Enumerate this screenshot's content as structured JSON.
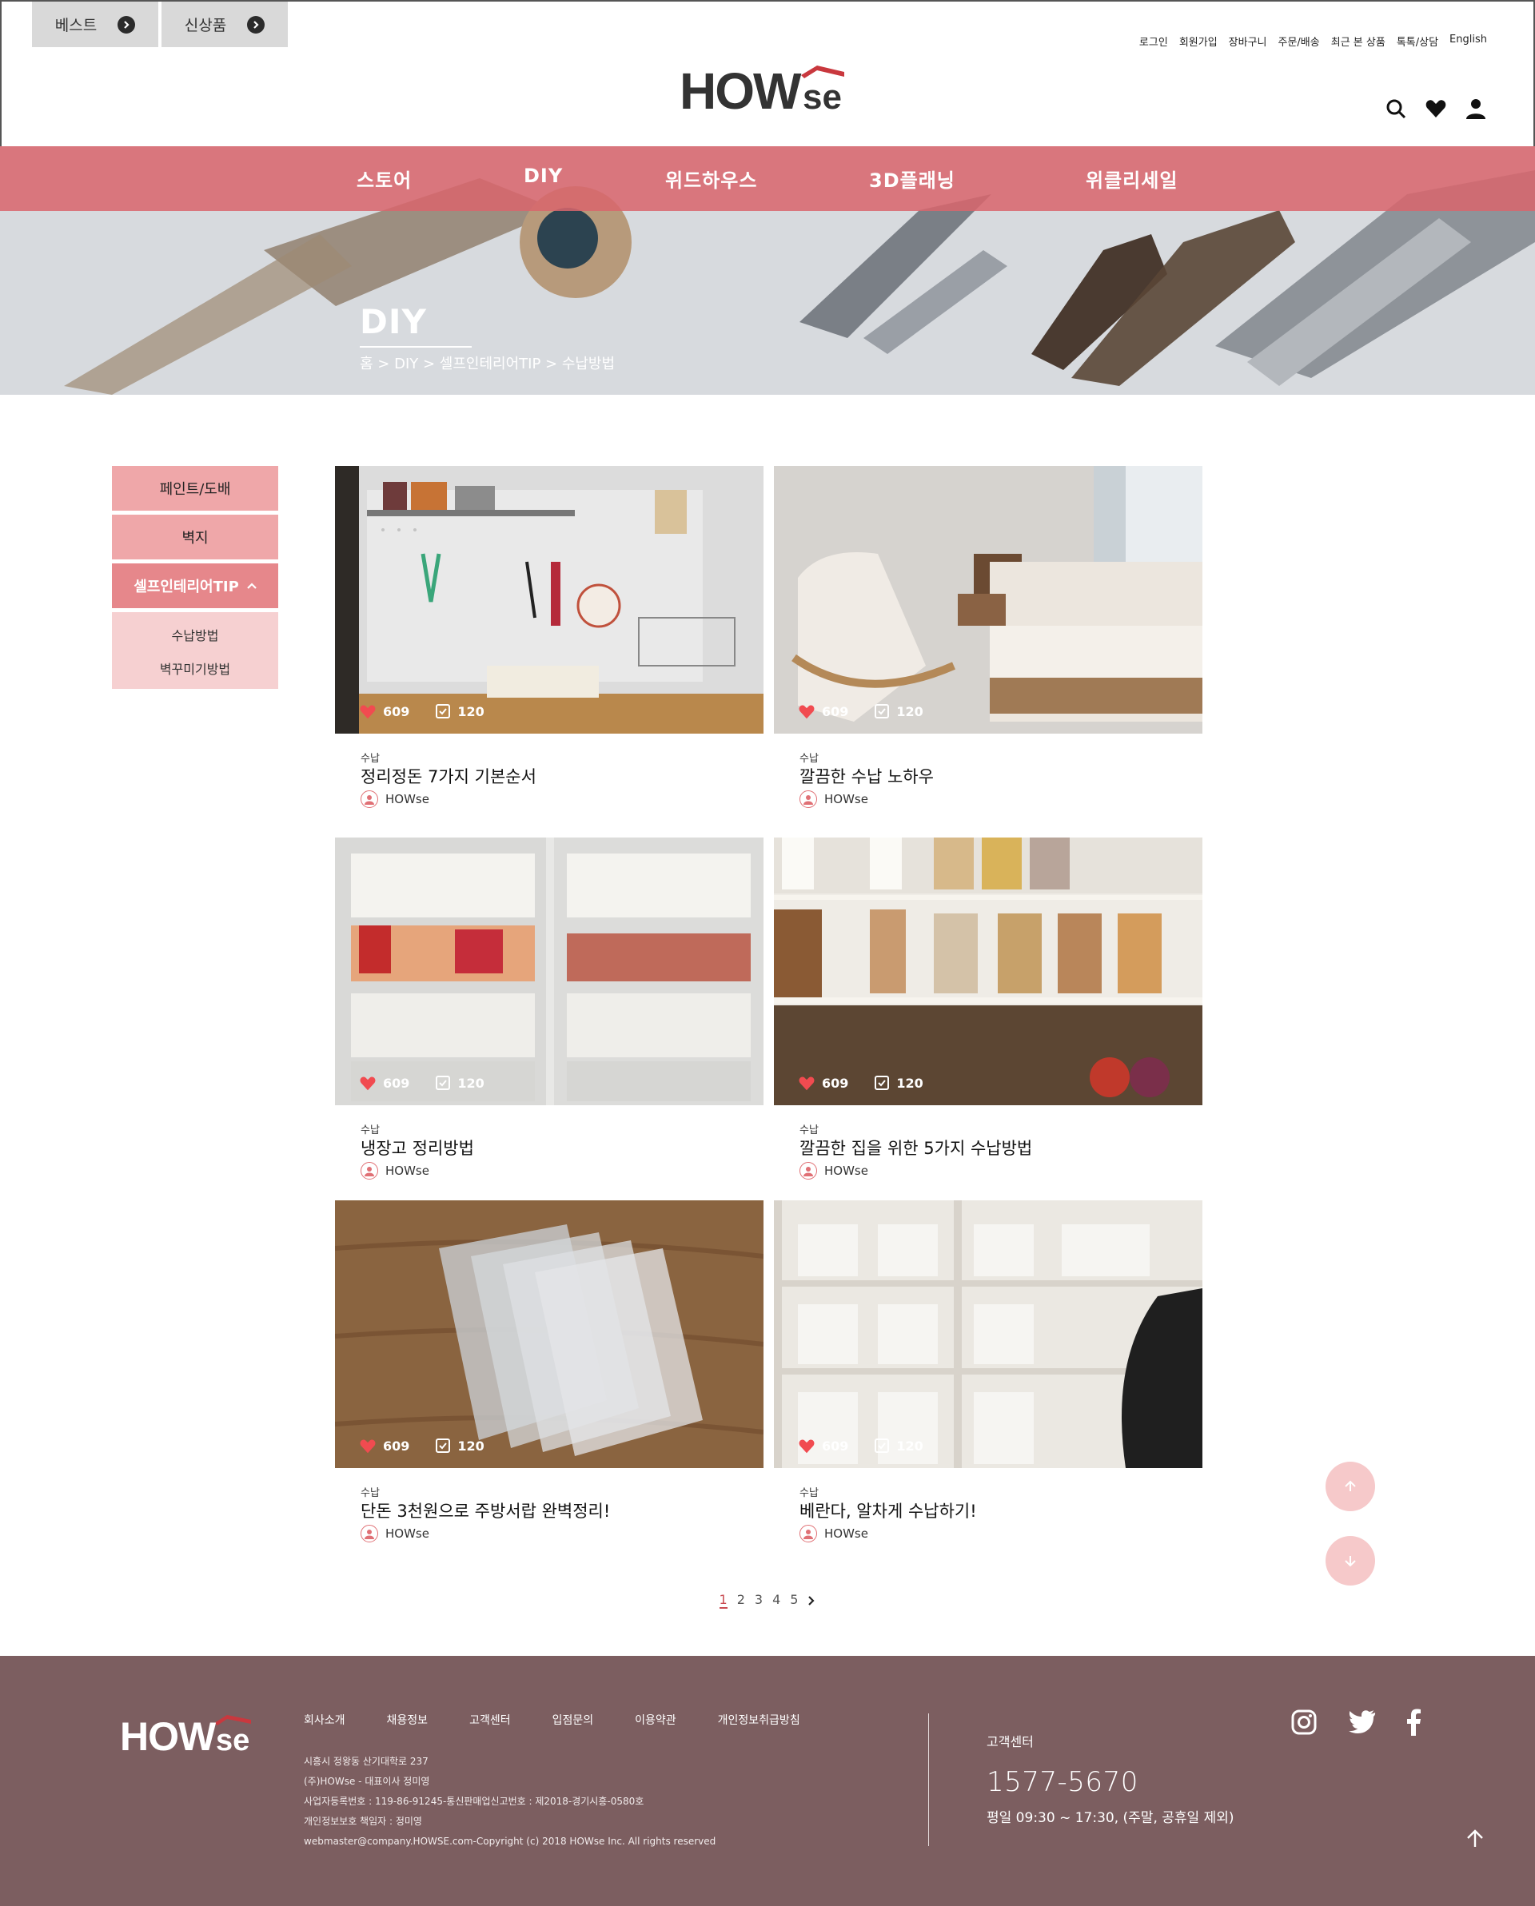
{
  "header": {
    "quick_tabs": [
      {
        "label": "베스트"
      },
      {
        "label": "신상품"
      }
    ],
    "util_links": [
      "로그인",
      "회원가입",
      "장바구니",
      "주문/배송",
      "최근 본 상품",
      "톡톡/상담",
      "English"
    ],
    "logo": "HOWse"
  },
  "nav": {
    "items": [
      "스토어",
      "DIY",
      "위드하우스",
      "3D플래닝",
      "위클리세일"
    ]
  },
  "hero": {
    "title": "DIY",
    "breadcrumb": "홈 > DIY > 셀프인테리어TIP > 수납방법"
  },
  "sidebar": {
    "items": [
      "페인트/도배",
      "벽지",
      "셀프인테리어TIP"
    ],
    "subitems": [
      "수납방법",
      "벽꾸미기방법"
    ]
  },
  "cards": [
    {
      "category": "수납",
      "title": "정리정돈 7가지 기본순서",
      "author": "HOWse",
      "likes": "609",
      "checks": "120"
    },
    {
      "category": "수납",
      "title": "깔끔한 수납 노하우",
      "author": "HOWse",
      "likes": "609",
      "checks": "120"
    },
    {
      "category": "수납",
      "title": "냉장고 정리방법",
      "author": "HOWse",
      "likes": "609",
      "checks": "120"
    },
    {
      "category": "수납",
      "title": "깔끔한 집을 위한 5가지 수납방법",
      "author": "HOWse",
      "likes": "609",
      "checks": "120"
    },
    {
      "category": "수납",
      "title": "단돈 3천원으로 주방서랍 완벽정리!",
      "author": "HOWse",
      "likes": "609",
      "checks": "120"
    },
    {
      "category": "수납",
      "title": "베란다, 알차게 수납하기!",
      "author": "HOWse",
      "likes": "609",
      "checks": "120"
    }
  ],
  "pagination": {
    "pages": [
      "1",
      "2",
      "3",
      "4",
      "5"
    ],
    "current": "1"
  },
  "footer": {
    "logo": "HOWse",
    "links": [
      "회사소개",
      "채용정보",
      "고객센터",
      "입점문의",
      "이용약관",
      "개인정보취급방침"
    ],
    "info": [
      "시흥시 정왕동 산기대학로 237",
      "(주)HOWse - 대표이사 정미영",
      "사업자등록번호 : 119-86-91245-통신판매업신고번호 : 제2018-경기시흥-0580호",
      "개인정보보호 책임자 : 정미영",
      "webmaster@company.HOWSE.com-Copyright (c) 2018 HOWse Inc. All rights reserved"
    ],
    "cs_label": "고객센터",
    "cs_phone": "1577-5670",
    "cs_hours": "평일 09:30 ~ 17:30, (주말, 공휴일 제외)"
  },
  "colors": {
    "nav": "#d9656c",
    "sidebar": "#efa7a9",
    "sidebar_active": "#e6878b",
    "footer": "#7c5e60",
    "accent": "#c94c52"
  }
}
